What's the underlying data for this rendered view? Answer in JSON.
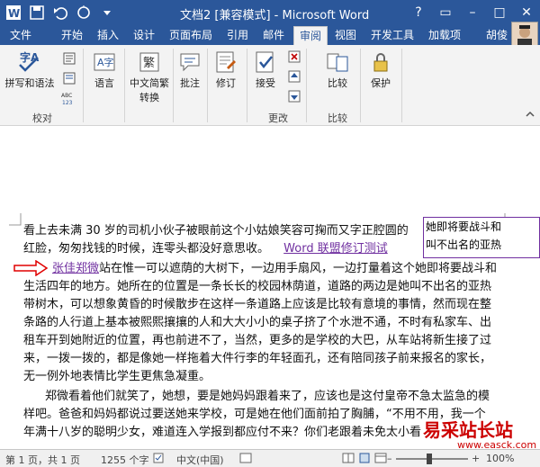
{
  "window": {
    "title": "文档2 [兼容模式] - Microsoft Word",
    "controls": [
      "?",
      "▭",
      "–",
      "□",
      "✕"
    ]
  },
  "tabs": [
    {
      "label": "文件"
    },
    {
      "label": "开始"
    },
    {
      "label": "插入"
    },
    {
      "label": "设计"
    },
    {
      "label": "页面布局"
    },
    {
      "label": "引用"
    },
    {
      "label": "邮件"
    },
    {
      "label": "审阅"
    },
    {
      "label": "视图"
    },
    {
      "label": "开发工具"
    },
    {
      "label": "加载项"
    }
  ],
  "user": {
    "name": "胡倰"
  },
  "ribbon": {
    "proofing": {
      "spelling": "拼写和语法",
      "group": "校对"
    },
    "language": {
      "label": "语言"
    },
    "chinese": {
      "label": "中文简繁",
      "label2": "转换"
    },
    "comment": {
      "label": "批注"
    },
    "track": {
      "label": "修订"
    },
    "accept": {
      "label": "接受"
    },
    "changes_group": "更改",
    "compare": {
      "label": "比较",
      "group": "比较"
    },
    "protect": {
      "label": "保护"
    }
  },
  "document": {
    "lines": [
      "看上去未满 30 岁的司机小伙子被眼前这个小姑娘笑容可掬而又字正腔圆的",
      "红脸，匆匆找钱的时候，连零头都没好意思收。",
      "站在惟一可以遮荫的大树下，一边用手扇风，一边打量着这个她即将要战斗和",
      "生活四年的地方。她所在的位置是一条长长的校园林荫道，道路的两边是她叫不出名的亚热",
      "带树木，可以想象黄昏的时候散步在这样一条道路上应该是比较有意境的事情，然而现在整",
      "条路的人行道上基本被熙熙攘攘的人和大大小小的桌子挤了个水泄不通，不时有私家车、出",
      "租车开到她附近的位置，再也前进不了，当然，更多的是学校的大巴，从车站将新生接了过",
      "来，一拨一拨的，都是像她一样拖着大件行李的年轻面孔，还有陪同孩子前来报名的家长，",
      "无一例外地表情比学生更焦急凝重。",
      "郑微看着他们就笑了，她想，要是她妈妈跟着来了，应该也是这付皇帝不急太监急的模",
      "样吧。爸爸和妈妈都说过要送她来学校，可是她在他们面前拍了胸脯，“不用不用，我一个",
      "年满十八岁的聪明少女，难道连入学报到都应付不来？你们老跟着未免太小看"
    ],
    "comment_label": "Word 联盟修订测试",
    "revised_name": "张佳郑微",
    "bubble": {
      "line1": "她即将要战斗和",
      "line2": "叫不出名的亚热"
    }
  },
  "status": {
    "page": "第 1 页，共 1 页",
    "words": "1255 个字",
    "language": "中文(中国)",
    "zoom": "100%"
  },
  "watermark": {
    "text": "易采站长站",
    "url": "www.easck.com"
  }
}
